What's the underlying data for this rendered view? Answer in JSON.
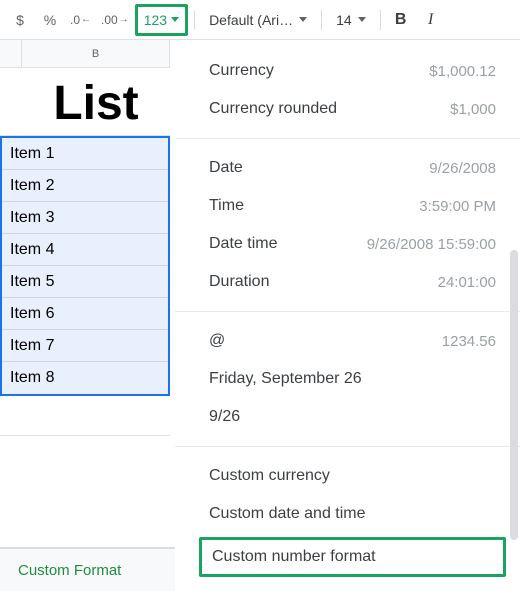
{
  "toolbar": {
    "dollar": "$",
    "percent": "%",
    "dec_decrease": ".0",
    "dec_increase": ".00",
    "format_label": "123",
    "font_label": "Default (Ari…",
    "font_size": "14",
    "bold": "B",
    "italic": "I"
  },
  "sheet": {
    "col_b": "B",
    "title": "List",
    "items": [
      "Item 1",
      "Item 2",
      "Item 3",
      "Item 4",
      "Item 5",
      "Item 6",
      "Item 7",
      "Item 8"
    ]
  },
  "tab": {
    "name": "Custom Format"
  },
  "menu": {
    "currency": {
      "label": "Currency",
      "example": "$1,000.12"
    },
    "currency_rounded": {
      "label": "Currency rounded",
      "example": "$1,000"
    },
    "date": {
      "label": "Date",
      "example": "9/26/2008"
    },
    "time": {
      "label": "Time",
      "example": "3:59:00 PM"
    },
    "date_time": {
      "label": "Date time",
      "example": "9/26/2008 15:59:00"
    },
    "duration": {
      "label": "Duration",
      "example": "24:01:00"
    },
    "at": {
      "label": "@",
      "example": "1234.56"
    },
    "friday": "Friday, September 26",
    "short_date": "9/26",
    "custom_currency": "Custom currency",
    "custom_date_time": "Custom date and time",
    "custom_number_format": "Custom number format"
  }
}
